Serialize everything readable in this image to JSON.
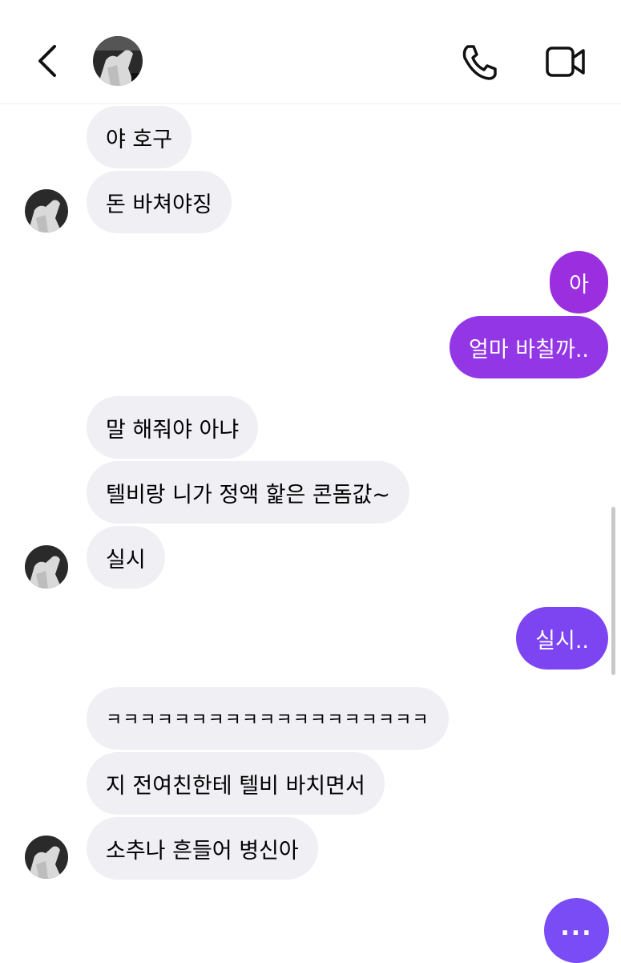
{
  "header": {
    "back_icon": "chevron-left-icon",
    "call_icon": "phone-icon",
    "video_icon": "video-camera-icon"
  },
  "messages": [
    {
      "side": "in",
      "text": "야 호구"
    },
    {
      "side": "in",
      "text": "돈 바쳐야징"
    },
    {
      "side": "out",
      "text": "아"
    },
    {
      "side": "out",
      "text": "얼마 바칠까.."
    },
    {
      "side": "in",
      "text": "말 해줘야 아냐"
    },
    {
      "side": "in",
      "text": "텔비랑 니가 정액 핥은 콘돔값~"
    },
    {
      "side": "in",
      "text": "실시"
    },
    {
      "side": "out",
      "text": "실시.."
    },
    {
      "side": "in",
      "text": "ㅋㅋㅋㅋㅋㅋㅋㅋㅋㅋㅋㅋㅋㅋㅋㅋㅋㅋㅋ"
    },
    {
      "side": "in",
      "text": "지 전여친한테 텔비 바치면서"
    },
    {
      "side": "in",
      "text": "소추나 흔들어 병신아"
    }
  ],
  "typing_indicator": "...",
  "colors": {
    "incoming_bubble": "#efeff4",
    "outgoing_purple": "#9b2fe0",
    "outgoing_violet": "#7a4cf6",
    "accent": "#7a4cf6"
  }
}
